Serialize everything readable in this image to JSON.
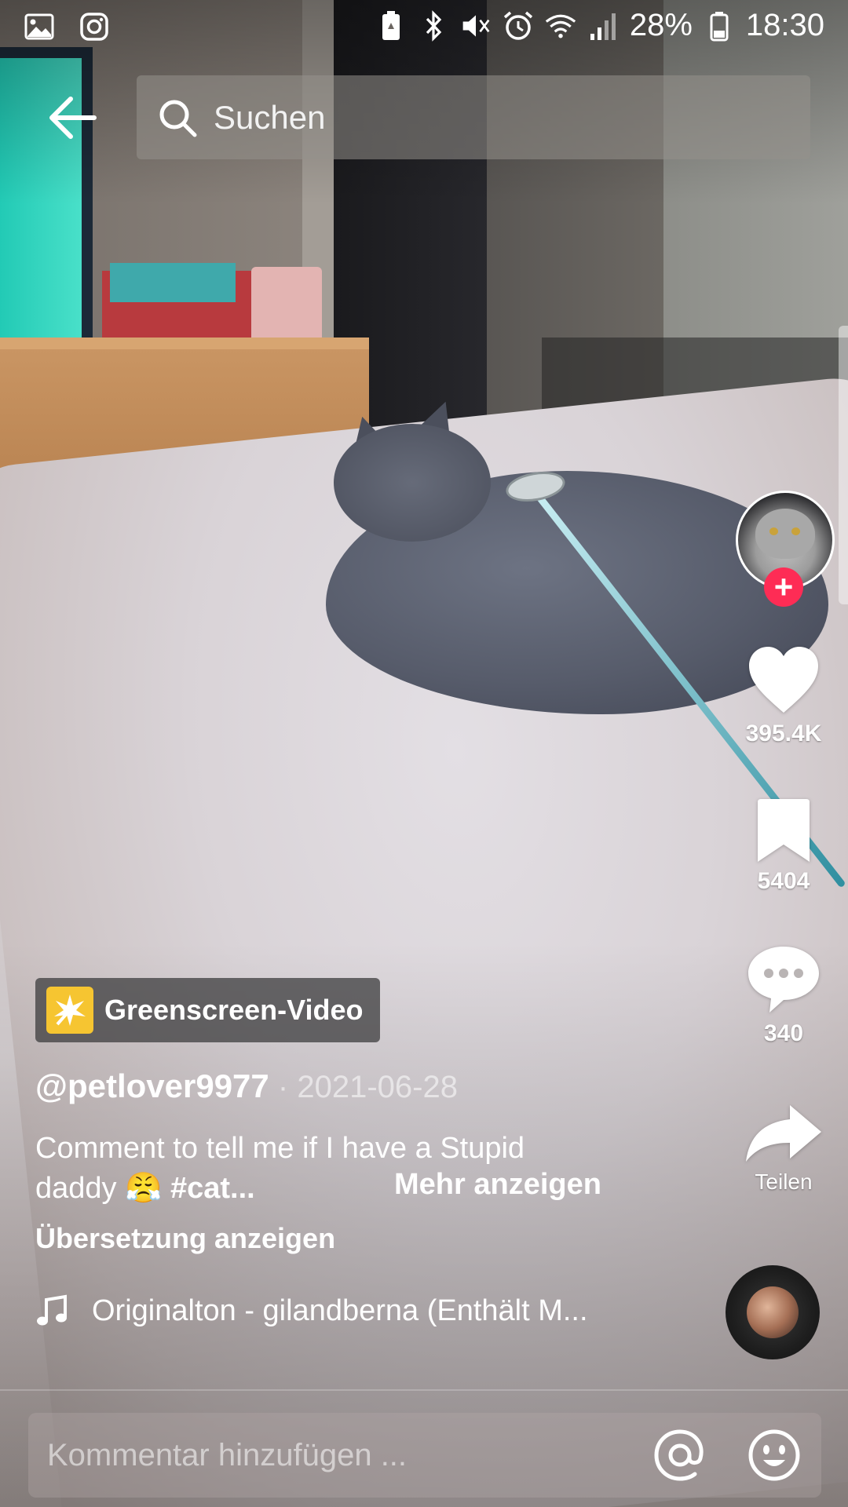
{
  "status_bar": {
    "battery_percent": "28%",
    "time": "18:30",
    "icons": [
      "gallery-icon",
      "instagram-icon",
      "battery-saver-icon",
      "bluetooth-icon",
      "mute-icon",
      "alarm-icon",
      "wifi-icon",
      "signal-icon",
      "battery-icon"
    ]
  },
  "nav": {
    "search_placeholder": "Suchen"
  },
  "actions": {
    "likes": "395.4K",
    "saves": "5404",
    "comments": "340",
    "share_label": "Teilen"
  },
  "video": {
    "effect_label": "Greenscreen-Video",
    "username": "@petlover9977",
    "separator": " · ",
    "date": "2021-06-28",
    "caption_text": "Comment to tell me if I have a Stupid daddy 😤 ",
    "caption_hashtag": "#cat...",
    "more_label": "Mehr anzeigen",
    "translate_label": "Übersetzung anzeigen",
    "music_label": "Originalton - gilandberna (Enthält M..."
  },
  "comment": {
    "placeholder": "Kommentar hinzufügen ..."
  },
  "colors": {
    "accent": "#fe2c55",
    "effect_icon_bg": "#f6c531"
  }
}
